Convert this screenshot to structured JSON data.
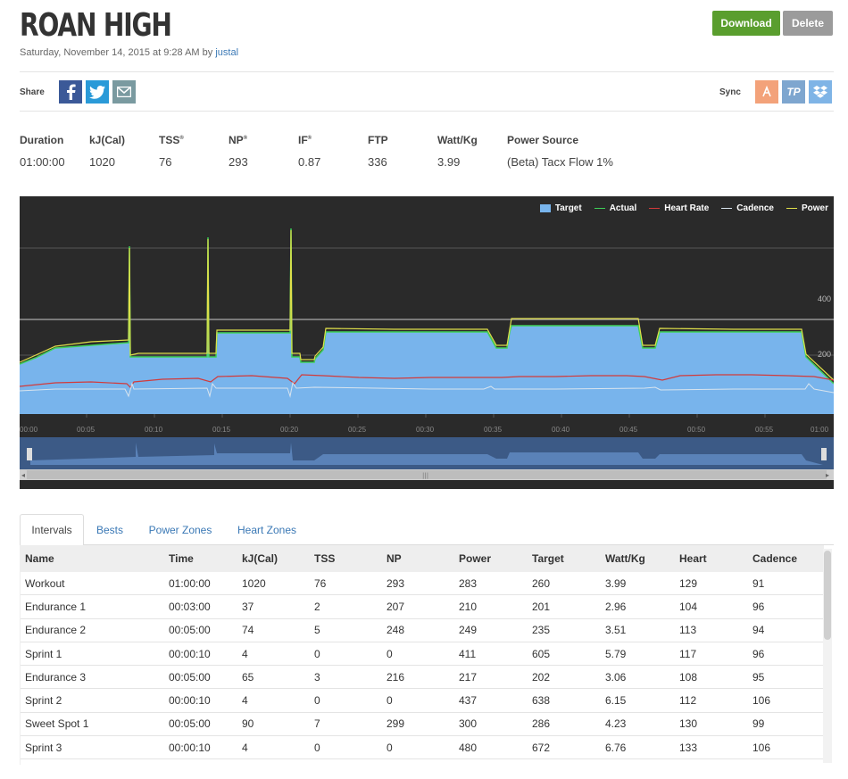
{
  "header": {
    "title": "ROAN HIGH",
    "date": "Saturday, November 14, 2015 at 9:28 AM by",
    "author": "justal",
    "download_label": "Download",
    "delete_label": "Delete"
  },
  "share": {
    "label": "Share",
    "icons": [
      "facebook-icon",
      "twitter-icon",
      "email-icon"
    ]
  },
  "sync": {
    "label": "Sync",
    "icons": [
      "strava-icon",
      "trainingpeaks-icon",
      "dropbox-icon"
    ]
  },
  "stats": [
    {
      "label": "Duration",
      "value": "01:00:00"
    },
    {
      "label": "kJ(Cal)",
      "value": "1020"
    },
    {
      "label": "TSS",
      "sup": "®",
      "value": "76"
    },
    {
      "label": "NP",
      "sup": "®",
      "value": "293"
    },
    {
      "label": "IF",
      "sup": "®",
      "value": "0.87"
    },
    {
      "label": "FTP",
      "value": "336"
    },
    {
      "label": "Watt/Kg",
      "value": "3.99"
    },
    {
      "label": "Power Source",
      "value": "(Beta) Tacx Flow 1%"
    }
  ],
  "chart": {
    "legend": [
      "Target",
      "Actual",
      "Heart Rate",
      "Cadence",
      "Power"
    ],
    "colors": {
      "target": "#78b4ec",
      "actual": "#3ed158",
      "heart": "#d23a3a",
      "cadence": "#d8e4ee",
      "power": "#e0e04a",
      "bg": "#2a2a2a"
    },
    "y_ticks": [
      "400",
      "200"
    ],
    "x_ticks": [
      "00:00",
      "00:05",
      "00:10",
      "00:15",
      "00:20",
      "00:25",
      "00:30",
      "00:35",
      "00:40",
      "00:45",
      "00:50",
      "00:55",
      "01:00"
    ]
  },
  "tabs": [
    "Intervals",
    "Bests",
    "Power Zones",
    "Heart Zones"
  ],
  "table": {
    "columns": [
      "Name",
      "Time",
      "kJ(Cal)",
      "TSS",
      "NP",
      "Power",
      "Target",
      "Watt/Kg",
      "Heart",
      "Cadence"
    ],
    "rows": [
      [
        "Workout",
        "01:00:00",
        "1020",
        "76",
        "293",
        "283",
        "260",
        "3.99",
        "129",
        "91"
      ],
      [
        "Endurance 1",
        "00:03:00",
        "37",
        "2",
        "207",
        "210",
        "201",
        "2.96",
        "104",
        "96"
      ],
      [
        "Endurance 2",
        "00:05:00",
        "74",
        "5",
        "248",
        "249",
        "235",
        "3.51",
        "113",
        "94"
      ],
      [
        "Sprint 1",
        "00:00:10",
        "4",
        "0",
        "0",
        "411",
        "605",
        "5.79",
        "117",
        "96"
      ],
      [
        "Endurance 3",
        "00:05:00",
        "65",
        "3",
        "216",
        "217",
        "202",
        "3.06",
        "108",
        "95"
      ],
      [
        "Sprint 2",
        "00:00:10",
        "4",
        "0",
        "0",
        "437",
        "638",
        "6.15",
        "112",
        "106"
      ],
      [
        "Sweet Spot 1",
        "00:05:00",
        "90",
        "7",
        "299",
        "300",
        "286",
        "4.23",
        "130",
        "99"
      ],
      [
        "Sprint 3",
        "00:00:10",
        "4",
        "0",
        "0",
        "480",
        "672",
        "6.76",
        "133",
        "106"
      ]
    ]
  }
}
